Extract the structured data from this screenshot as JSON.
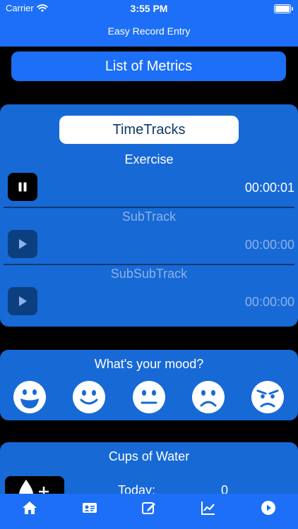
{
  "status_bar": {
    "carrier": "Carrier",
    "time": "3:55 PM"
  },
  "nav": {
    "title": "Easy Record Entry"
  },
  "metrics_button": {
    "label": "List of Metrics"
  },
  "timetracks": {
    "button_label": "TimeTracks",
    "tracks": [
      {
        "title": "Exercise",
        "time": "00:00:01",
        "state": "running",
        "control_icon": "pause-icon"
      },
      {
        "title": "SubTrack",
        "time": "00:00:00",
        "state": "stopped",
        "control_icon": "play-icon"
      },
      {
        "title": "SubSubTrack",
        "time": "00:00:00",
        "state": "stopped",
        "control_icon": "play-icon"
      }
    ]
  },
  "mood": {
    "title": "What's your mood?",
    "faces": [
      "grinning-face-icon",
      "smiling-face-icon",
      "neutral-face-icon",
      "frowning-face-icon",
      "angry-face-icon"
    ]
  },
  "water": {
    "title": "Cups of Water",
    "today_label": "Today:",
    "today_value": "0",
    "add_icon": "water-drop-plus-icon"
  },
  "tabbar": {
    "items": [
      "home-icon",
      "contact-card-icon",
      "edit-icon",
      "chart-icon",
      "play-circle-icon"
    ]
  },
  "colors": {
    "accent": "#1c6ff6",
    "card": "#1769d6",
    "background": "#000000",
    "active_text": "#ffffff",
    "inactive_text": "#8fb2e6"
  }
}
